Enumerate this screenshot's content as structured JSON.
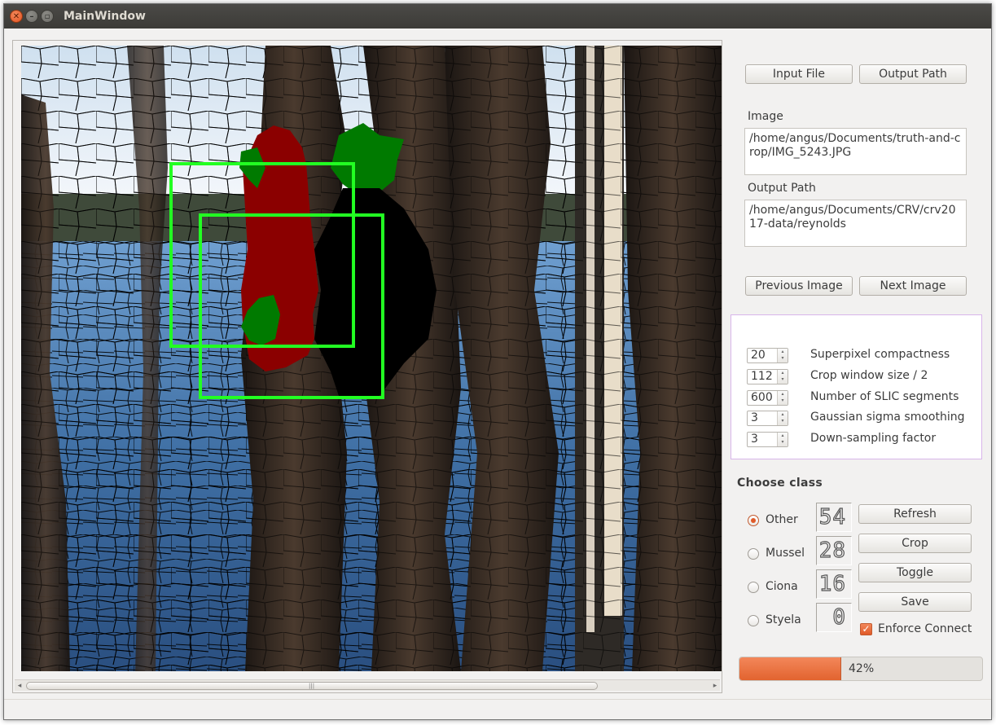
{
  "window": {
    "title": "MainWindow"
  },
  "titlebar_icons": {
    "close": "close-icon",
    "minimize": "minimize-icon",
    "maximize": "maximize-icon"
  },
  "image_view": {
    "description_icon": "segmentation-image"
  },
  "buttons": {
    "input_file": "Input File",
    "output_path": "Output Path",
    "previous_image": "Previous Image",
    "next_image": "Next Image",
    "refresh": "Refresh",
    "crop": "Crop",
    "toggle": "Toggle",
    "save": "Save"
  },
  "fields": {
    "image_label": "Image",
    "image_value": "/home/angus/Documents/truth-and-crop/IMG_5243.JPG",
    "output_label": "Output Path",
    "output_value": "/home/angus/Documents/CRV/crv2017-data/reynolds"
  },
  "params": [
    {
      "value": "20",
      "label": "Superpixel compactness"
    },
    {
      "value": "112",
      "label": "Crop window size / 2"
    },
    {
      "value": "600",
      "label": "Number of SLIC segments"
    },
    {
      "value": "3",
      "label": "Gaussian sigma smoothing"
    },
    {
      "value": "3",
      "label": "Down-sampling factor"
    }
  ],
  "classes": {
    "heading": "Choose  class",
    "items": [
      {
        "label": "Other",
        "count": "54",
        "selected": true
      },
      {
        "label": "Mussel",
        "count": "28",
        "selected": false
      },
      {
        "label": "Ciona",
        "count": "16",
        "selected": false
      },
      {
        "label": "Styela",
        "count": "0",
        "selected": false
      }
    ]
  },
  "enforce_connect": {
    "label": "Enforce Connect",
    "checked": true
  },
  "progress": {
    "value": 42,
    "text": "42%"
  },
  "colors": {
    "accent": "#e05a28",
    "class_other": "#8b0000",
    "class_green": "#007a00",
    "crop_box": "#22ff22"
  }
}
